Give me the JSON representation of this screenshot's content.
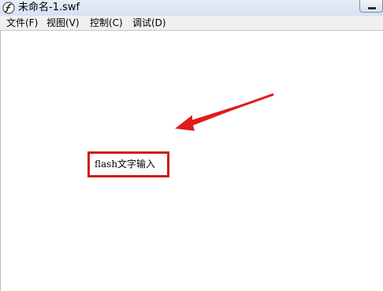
{
  "window": {
    "title": "未命名-1.swf"
  },
  "menubar": {
    "items": [
      {
        "label": "文件(F)"
      },
      {
        "label": "视图(V)"
      },
      {
        "label": "控制(C)"
      },
      {
        "label": "调试(D)"
      }
    ]
  },
  "stage": {
    "text_field": "flash文字输入",
    "annotation": {
      "box_color": "#d01c1c",
      "arrow_color": "#e01b1b"
    }
  },
  "icons": {
    "app_icon": "flash-player-icon",
    "minimize": "minimize-icon"
  }
}
